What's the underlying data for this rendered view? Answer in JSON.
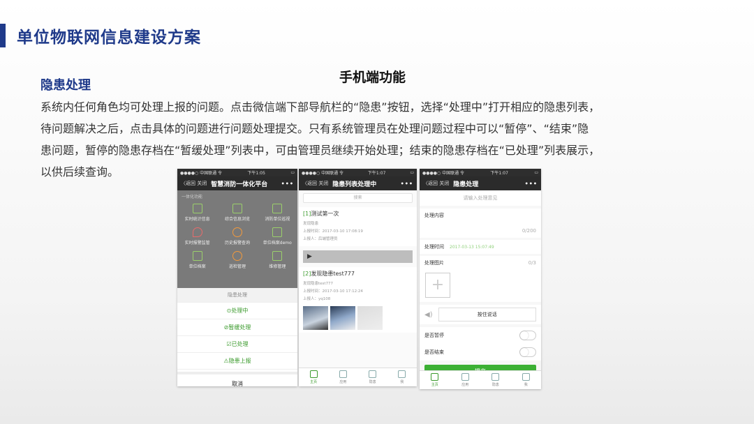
{
  "slide": {
    "title": "单位物联网信息建设方案",
    "subtitle": "手机端功能",
    "section": "隐患处理",
    "paragraph_lines": [
      "系统内任何角色均可处理上报的问题。点击微信端下部导航栏的“隐患”按钮，选择“处理中”打开相应的隐患列表，",
      "待问题解决之后，点击具体的问题进行问题处理提交。只有系统管理员在处理问题过程中可以“暂停”、“结束”隐",
      "患问题，暂停的隐患存档在“暂缓处理”列表中，可由管理员继续开始处理；结束的隐患存档在“已处理”列表展示，",
      "以供后续查询。"
    ],
    "accent_color": "#1f3a8a"
  },
  "phone1": {
    "status_left": "●●●●○ 中国联通 令",
    "status_time": "下午1:05",
    "back": "〈返回  关闭",
    "title": "智慧消防一体化平台",
    "more": "•••",
    "grid_caption": "一体化功能",
    "grid": [
      "实时统计信息",
      "综合信息浏览",
      "消防单位巡视",
      "实时报警监管",
      "历史报警查询",
      "单位档案demo",
      "单位档案",
      "巡检管理",
      "维修管理"
    ],
    "sheet_head": "隐患处理",
    "options": [
      "⊙处理中",
      "⊘暂缓处理",
      "☑已处理",
      "⚠隐患上报"
    ],
    "cancel": "取消"
  },
  "phone2": {
    "status_left": "●●●●○ 中国联通 令",
    "status_time": "下午1:07",
    "back": "〈返回  关闭",
    "title": "隐患列表处理中",
    "more": "•••",
    "search_placeholder": "搜索",
    "items": [
      {
        "tag": "[1]",
        "title": "测试第一次",
        "desc": "发现隐患",
        "time": "上报时间：2017-03-10 17:08:19",
        "reporter": "上报人：后端管理员"
      },
      {
        "tag": "[2]",
        "title": "发现隐患test777",
        "desc": "发现隐患test777",
        "time": "上报时间：2017-03-10 17:12:24",
        "reporter": "上报人：yq108"
      }
    ],
    "play": "▶",
    "tabs": [
      "主页",
      "应用",
      "隐患",
      "我"
    ]
  },
  "phone3": {
    "status_left": "●●●●○ 中国联通 令",
    "status_time": "下午1:07",
    "back": "〈返回  关闭",
    "title": "隐患处理",
    "more": "•••",
    "input_placeholder": "请输入处理意见",
    "content_label": "处理内容",
    "content_counter": "0/200",
    "time_label": "处理时间",
    "time_value": "2017-03-13 15:07:49",
    "image_label": "处理图片",
    "image_counter": "0/3",
    "voice_icon": "◀)",
    "voice_button": "按住说话",
    "pause_label": "是否暂停",
    "end_label": "是否结束",
    "submit": "提交",
    "tabs": [
      "主页",
      "应用",
      "隐患",
      "我"
    ]
  }
}
